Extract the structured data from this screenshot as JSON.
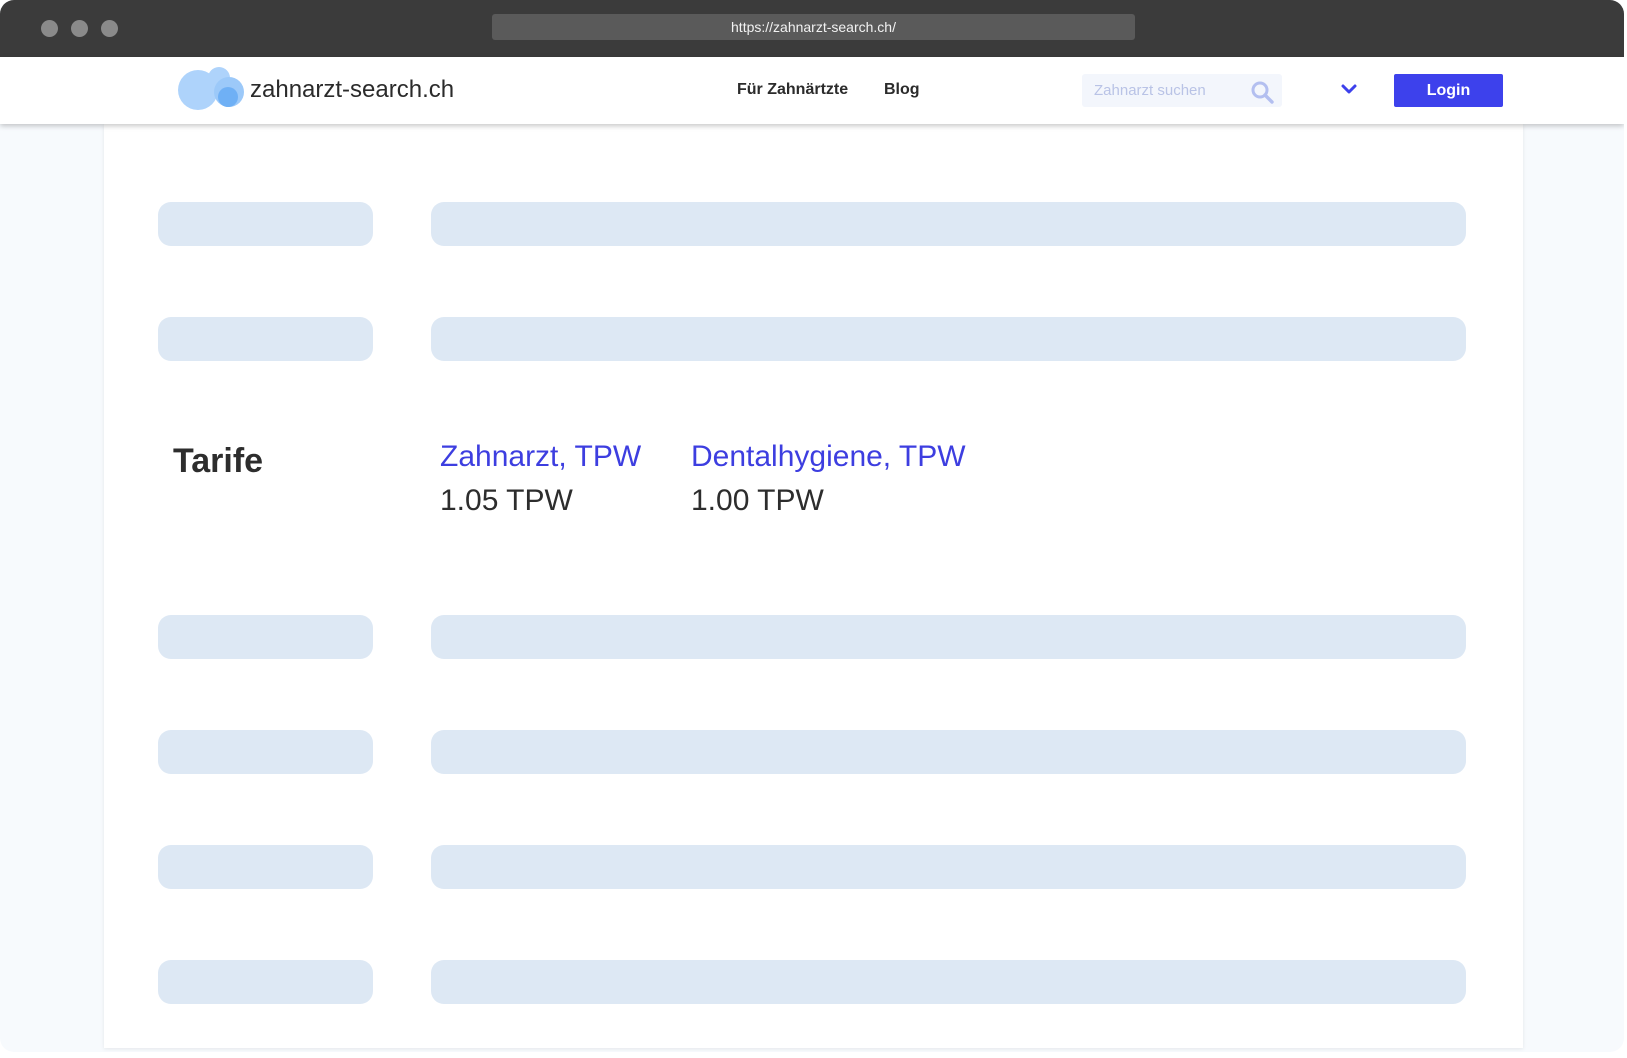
{
  "browser": {
    "url": "https://zahnarzt-search.ch/"
  },
  "header": {
    "logo_text": "zahnarzt-search.ch",
    "nav": [
      {
        "label": "Für Zahnärtzte"
      },
      {
        "label": "Blog"
      }
    ],
    "search": {
      "placeholder": "Zahnarzt suchen",
      "value": ""
    },
    "login_label": "Login"
  },
  "main": {
    "tarife": {
      "heading": "Tarife",
      "items": [
        {
          "label": "Zahnarzt, TPW",
          "value": "1.05 TPW"
        },
        {
          "label": "Dentalhygiene, TPW",
          "value": "1.00 TPW"
        }
      ]
    }
  },
  "icons": {
    "search": "search-icon",
    "chevron": "chevron-down-icon",
    "logo": "logo-bubbles-icon"
  },
  "colors": {
    "accent": "#3d41ec",
    "link": "#3d3ee0",
    "skeleton": "#dde8f4",
    "titlebar": "#3b3b3b",
    "logo_light": "#aed3fb",
    "logo_mid": "#6fb0f5"
  }
}
